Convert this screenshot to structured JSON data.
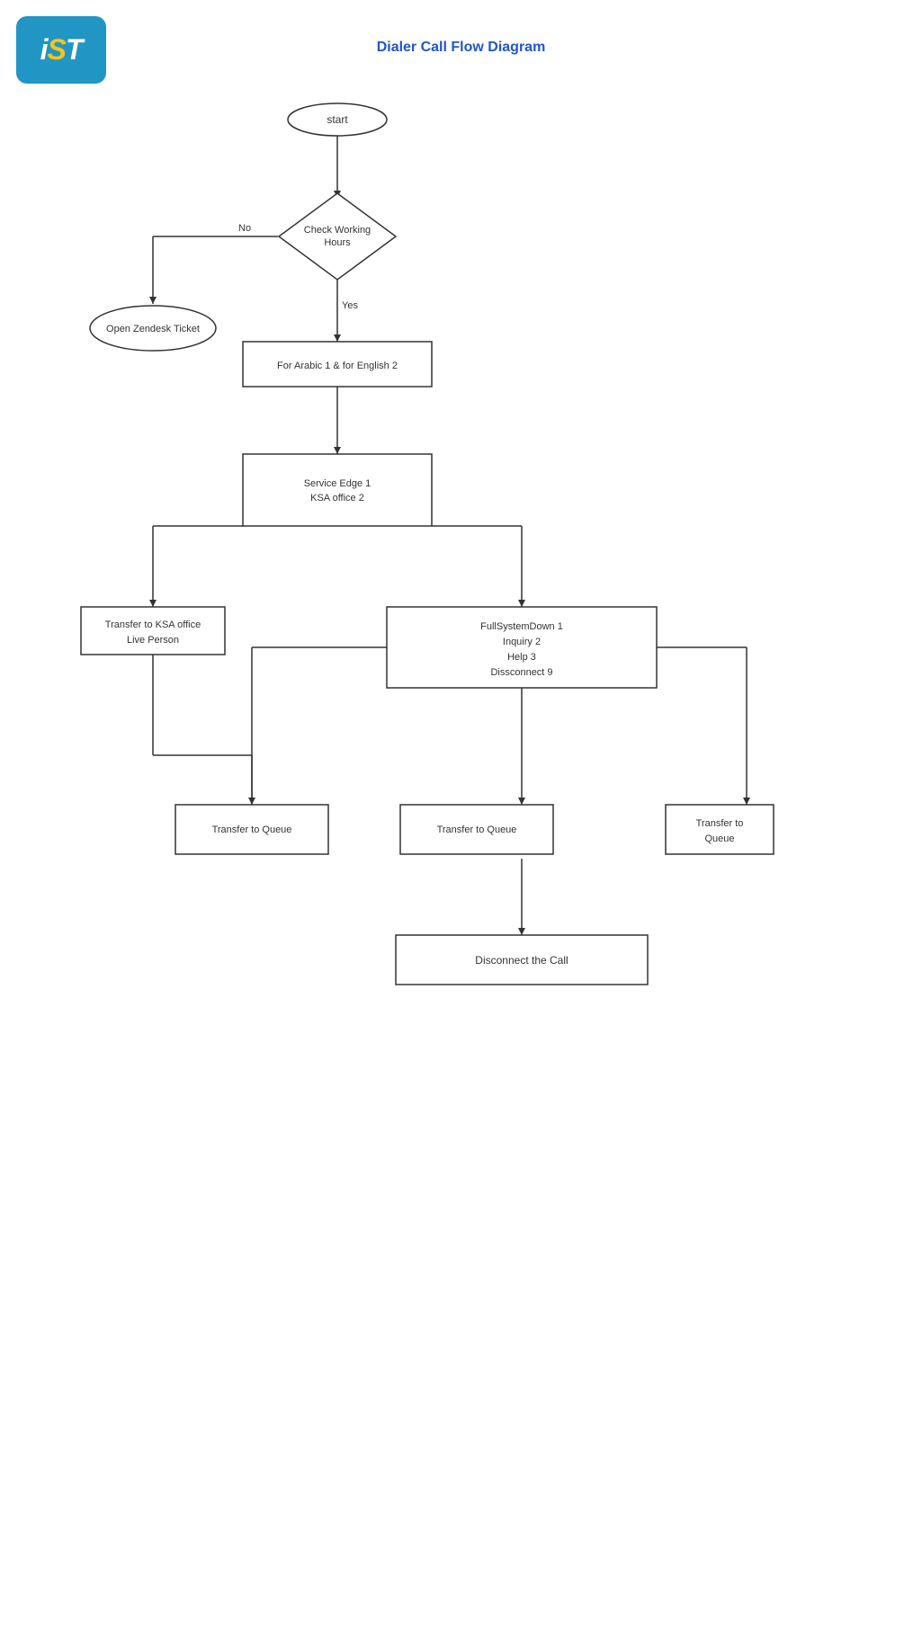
{
  "logo": {
    "text": "iST",
    "dot_color": "#f5c518",
    "bg_color": "#2196c4"
  },
  "title": "Dialer Call Flow Diagram",
  "nodes": {
    "start": "start",
    "check_working_hours": "Check Working\nHours",
    "no_label": "No",
    "yes_label": "Yes",
    "open_zendesk": "Open Zendesk Ticket",
    "arabic_english": "For Arabic 1 & for English 2",
    "service_edge": "Service Edge 1\nKSA office 2",
    "transfer_ksa": "Transfer to KSA office\nLive Person",
    "full_system_down": "FullSystemDown 1\nInquiry 2\nHelp 3\nDissconnect 9",
    "transfer_queue_left": "Transfer to Queue",
    "transfer_queue_middle": "Transfer to Queue",
    "transfer_queue_right": "Transfer to\nQueue",
    "disconnect": "Disconnect the Call"
  }
}
